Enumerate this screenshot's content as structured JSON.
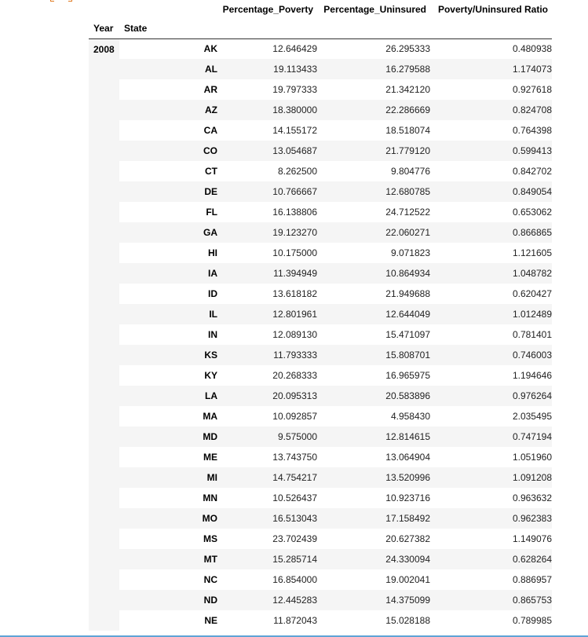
{
  "table": {
    "columns": [
      "Percentage_Poverty",
      "Percentage_Uninsured",
      "Poverty/Uninsured Ratio"
    ],
    "index_names": [
      "Year",
      "State"
    ],
    "year": "2008",
    "rows": [
      {
        "state": "AK",
        "poverty": "12.646429",
        "uninsured": "26.295333",
        "ratio": "0.480938"
      },
      {
        "state": "AL",
        "poverty": "19.113433",
        "uninsured": "16.279588",
        "ratio": "1.174073"
      },
      {
        "state": "AR",
        "poverty": "19.797333",
        "uninsured": "21.342120",
        "ratio": "0.927618"
      },
      {
        "state": "AZ",
        "poverty": "18.380000",
        "uninsured": "22.286669",
        "ratio": "0.824708"
      },
      {
        "state": "CA",
        "poverty": "14.155172",
        "uninsured": "18.518074",
        "ratio": "0.764398"
      },
      {
        "state": "CO",
        "poverty": "13.054687",
        "uninsured": "21.779120",
        "ratio": "0.599413"
      },
      {
        "state": "CT",
        "poverty": "8.262500",
        "uninsured": "9.804776",
        "ratio": "0.842702"
      },
      {
        "state": "DE",
        "poverty": "10.766667",
        "uninsured": "12.680785",
        "ratio": "0.849054"
      },
      {
        "state": "FL",
        "poverty": "16.138806",
        "uninsured": "24.712522",
        "ratio": "0.653062"
      },
      {
        "state": "GA",
        "poverty": "19.123270",
        "uninsured": "22.060271",
        "ratio": "0.866865"
      },
      {
        "state": "HI",
        "poverty": "10.175000",
        "uninsured": "9.071823",
        "ratio": "1.121605"
      },
      {
        "state": "IA",
        "poverty": "11.394949",
        "uninsured": "10.864934",
        "ratio": "1.048782"
      },
      {
        "state": "ID",
        "poverty": "13.618182",
        "uninsured": "21.949688",
        "ratio": "0.620427"
      },
      {
        "state": "IL",
        "poverty": "12.801961",
        "uninsured": "12.644049",
        "ratio": "1.012489"
      },
      {
        "state": "IN",
        "poverty": "12.089130",
        "uninsured": "15.471097",
        "ratio": "0.781401"
      },
      {
        "state": "KS",
        "poverty": "11.793333",
        "uninsured": "15.808701",
        "ratio": "0.746003"
      },
      {
        "state": "KY",
        "poverty": "20.268333",
        "uninsured": "16.965975",
        "ratio": "1.194646"
      },
      {
        "state": "LA",
        "poverty": "20.095313",
        "uninsured": "20.583896",
        "ratio": "0.976264"
      },
      {
        "state": "MA",
        "poverty": "10.092857",
        "uninsured": "4.958430",
        "ratio": "2.035495"
      },
      {
        "state": "MD",
        "poverty": "9.575000",
        "uninsured": "12.814615",
        "ratio": "0.747194"
      },
      {
        "state": "ME",
        "poverty": "13.743750",
        "uninsured": "13.064904",
        "ratio": "1.051960"
      },
      {
        "state": "MI",
        "poverty": "14.754217",
        "uninsured": "13.520996",
        "ratio": "1.091208"
      },
      {
        "state": "MN",
        "poverty": "10.526437",
        "uninsured": "10.923716",
        "ratio": "0.963632"
      },
      {
        "state": "MO",
        "poverty": "16.513043",
        "uninsured": "17.158492",
        "ratio": "0.962383"
      },
      {
        "state": "MS",
        "poverty": "23.702439",
        "uninsured": "20.627382",
        "ratio": "1.149076"
      },
      {
        "state": "MT",
        "poverty": "15.285714",
        "uninsured": "24.330094",
        "ratio": "0.628264"
      },
      {
        "state": "NC",
        "poverty": "16.854000",
        "uninsured": "19.002041",
        "ratio": "0.886957"
      },
      {
        "state": "ND",
        "poverty": "12.445283",
        "uninsured": "14.375099",
        "ratio": "0.865753"
      },
      {
        "state": "NE",
        "poverty": "11.872043",
        "uninsured": "15.028188",
        "ratio": "0.789985"
      }
    ]
  },
  "colors": {
    "prompt_bracket": "#e07a20",
    "row_stripe": "#f5f5f5",
    "scroll_rule": "#5fa4d6"
  }
}
